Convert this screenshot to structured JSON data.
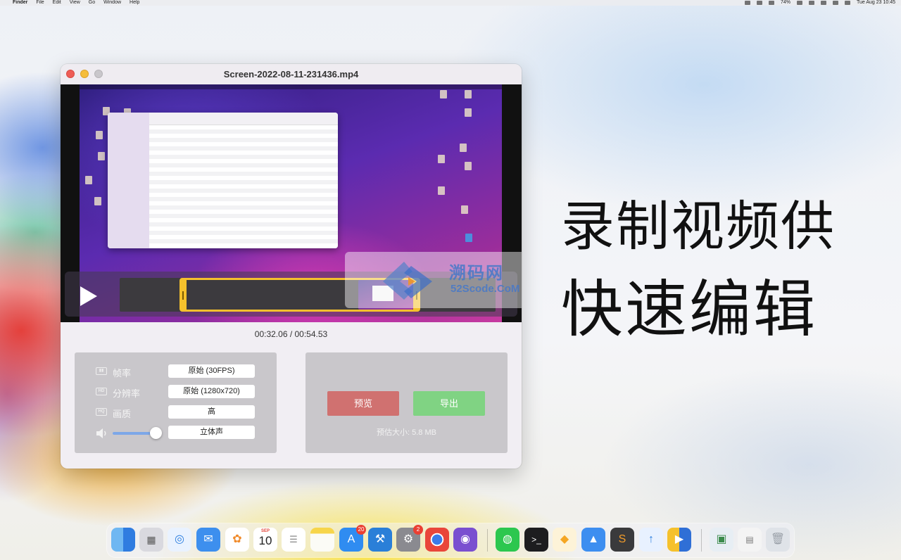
{
  "menubar": {
    "app": "Finder",
    "items": [
      "File",
      "Edit",
      "View",
      "Go",
      "Window",
      "Help"
    ],
    "battery": "74%",
    "clock": "Tue Aug 23  10:45"
  },
  "window": {
    "title": "Screen-2022-08-11-231436.mp4",
    "timecode": "00:32.06 / 00:54.53",
    "trim": {
      "start_fraction": 0.16,
      "end_fraction": 0.8
    },
    "watermark": {
      "text": "溯码网",
      "sub": "52Scode.CoM"
    },
    "settings": {
      "framerate": {
        "label": "帧率",
        "value": "原始 (30FPS)"
      },
      "resolution": {
        "label": "分辨率",
        "value": "原始 (1280x720)"
      },
      "quality": {
        "label": "画质",
        "value": "高"
      },
      "audio": {
        "value": "立体声",
        "volume_fraction": 0.85
      }
    },
    "preview_label": "预览",
    "export_label": "导出",
    "estimated_size": "预估大小: 5.8 MB"
  },
  "headline": {
    "line1": "录制视频供",
    "line2": "快速编辑"
  },
  "dock": {
    "calendar_month": "SEP",
    "calendar_day": "10",
    "appstore_badge": "20",
    "settings_badge": "2"
  },
  "colors": {
    "preview_button": "#d07170",
    "export_button": "#80d383",
    "trim_handles": "#f5c12c"
  }
}
